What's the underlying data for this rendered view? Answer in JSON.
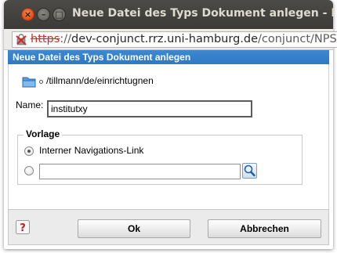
{
  "window": {
    "title": "Neue Datei des Typs Dokument anlegen - Ic",
    "controls": {
      "close": "×",
      "minimize": "–",
      "maximize": "□"
    }
  },
  "urlbar": {
    "protocol": "https",
    "separator": "://",
    "host": "dev-conjunct.rrz.uni-hamburg.de",
    "path": "/conjunct/NPS/p",
    "lock_icon": "broken-lock-icon"
  },
  "dialog": {
    "title": "Neue Datei des Typs Dokument anlegen",
    "folder_icon": "folder-icon",
    "path": "/tillmann/de/einrichtugnen",
    "name_label": "Name:",
    "name_value": "institutxy",
    "vorlage": {
      "legend": "Vorlage",
      "option_internal_label": "Interner Navigations-Link",
      "option_internal_selected": true,
      "option_link_selected": false,
      "link_value": ""
    },
    "search_icon": "magnifier-icon"
  },
  "footer": {
    "help_icon": "help-icon",
    "ok_label": "Ok",
    "cancel_label": "Abbrechen"
  },
  "colors": {
    "titlebar": "#3e3d39",
    "dialog_title_bg": "#3480c9",
    "close_button": "#e0531f",
    "footer_bg": "#ebebeb"
  }
}
